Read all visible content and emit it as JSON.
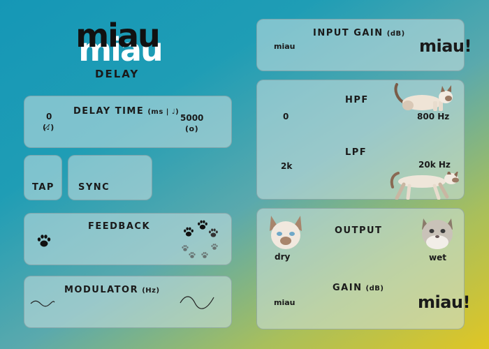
{
  "logo": {
    "text": "miau",
    "subtitle": "DELAY"
  },
  "delay_time": {
    "label": "DELAY TIME",
    "unit": "(ms | ♩)",
    "min": "0",
    "min_icon": "(♩̸)",
    "max": "5000",
    "max_icon": "(o)"
  },
  "tap": {
    "label": "TAP"
  },
  "sync": {
    "label": "SYNC"
  },
  "feedback": {
    "label": "FEEDBACK",
    "min_icon": "paw-icon",
    "max_icon": "paw-cluster-icon"
  },
  "modulator": {
    "label": "MODULATOR",
    "unit": "(Hz)",
    "min_icon": "small-wave-icon",
    "max_icon": "large-wave-icon"
  },
  "input_gain": {
    "label": "INPUT GAIN",
    "unit": "(dB)",
    "min": "miau",
    "max": "miau!"
  },
  "hpf": {
    "label": "HPF",
    "min": "0",
    "max": "800 Hz"
  },
  "lpf": {
    "label": "LPF",
    "min": "2k",
    "max": "20k Hz"
  },
  "output": {
    "label": "OUTPUT",
    "dry": "dry",
    "wet": "wet"
  },
  "gain": {
    "label": "GAIN",
    "unit": "(dB)",
    "min": "miau",
    "max": "miau!"
  }
}
